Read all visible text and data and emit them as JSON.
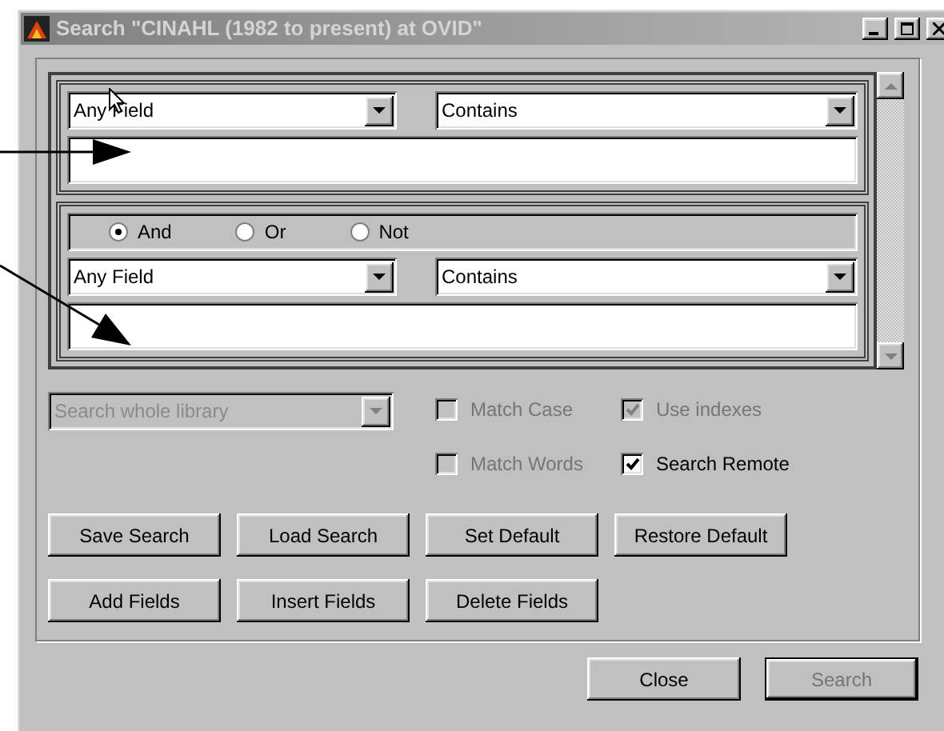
{
  "window": {
    "title": "Search \"CINAHL (1982 to present) at OVID\""
  },
  "criteria": [
    {
      "field": "Any Field",
      "operator": "Contains"
    },
    {
      "connectors": [
        {
          "label": "And",
          "selected": true
        },
        {
          "label": "Or",
          "selected": false
        },
        {
          "label": "Not",
          "selected": false
        }
      ],
      "field": "Any Field",
      "operator": "Contains"
    }
  ],
  "scope": {
    "value": "Search whole library",
    "disabled": true
  },
  "options": [
    {
      "label": "Match Case",
      "checked": false,
      "disabled": true
    },
    {
      "label": "Use indexes",
      "checked": true,
      "disabled": true
    },
    {
      "label": "Match Words",
      "checked": false,
      "disabled": true
    },
    {
      "label": "Search Remote",
      "checked": true,
      "disabled": false
    }
  ],
  "actions": [
    [
      "Save Search",
      "Load Search",
      "Set Default",
      "Restore Default"
    ],
    [
      "Add Fields",
      "Insert Fields",
      "Delete Fields"
    ]
  ],
  "dialog_buttons": [
    {
      "label": "Close",
      "disabled": false,
      "default": false
    },
    {
      "label": "Search",
      "disabled": true,
      "default": true
    }
  ]
}
